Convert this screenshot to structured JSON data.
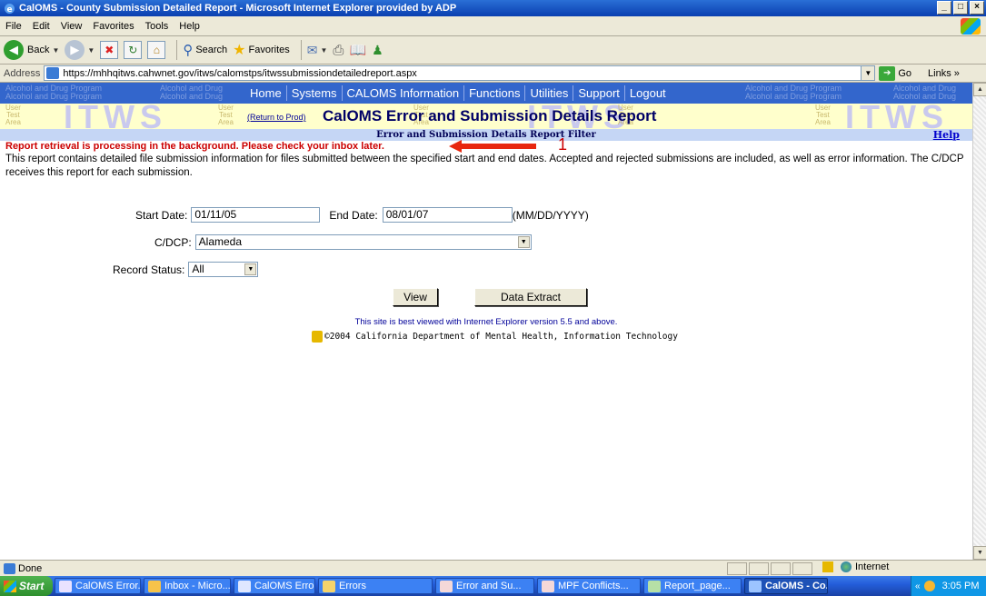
{
  "window": {
    "title": "CalOMS - County Submission Detailed Report - Microsoft Internet Explorer provided by ADP",
    "controls": [
      "_",
      "□",
      "×"
    ]
  },
  "menu": [
    "File",
    "Edit",
    "View",
    "Favorites",
    "Tools",
    "Help"
  ],
  "toolbar": {
    "back": "Back",
    "search": "Search",
    "favorites": "Favorites"
  },
  "address": {
    "label": "Address",
    "url": "https://mhhqitws.cahwnet.gov/itws/calomstps/itwssubmissiondetailedreport.aspx",
    "go": "Go",
    "links": "Links"
  },
  "nav": {
    "bg_left_1": "Alcohol and Drug Program",
    "bg_left_2": "Alcohol and Drug",
    "bg_right_1": "Alcohol and Drug Program",
    "bg_right_2": "Alcohol and Drug",
    "items": [
      "Home",
      "Systems",
      "CALOMS Information",
      "Functions",
      "Utilities",
      "Support",
      "Logout"
    ]
  },
  "banner": {
    "watermark": "ITWS",
    "watermark_right": "ITWS ITW",
    "user_test_area": "User\nTest\nArea",
    "return_link": "(Return to Prod)",
    "title": "CalOMS Error and Submission Details Report"
  },
  "filter": {
    "heading": "Error and Submission Details Report Filter",
    "help": "Help"
  },
  "notice": {
    "message": "Report retrieval is processing in the background. Please check your inbox later.",
    "callout_number": "1",
    "arrow_color": "#e8280f"
  },
  "description": "This report contains detailed file submission information for files submitted between the specified start and end dates.  Accepted and rejected submissions are included, as well as error information.  The C/DCP receives this report for each submission.",
  "form": {
    "start_label": "Start Date:",
    "start_value": "01/11/05",
    "end_label": "End Date:",
    "end_value": "08/01/07",
    "date_format": "(MM/DD/YYYY)",
    "cdcp_label": "C/DCP:",
    "cdcp_value": "Alameda",
    "status_label": "Record Status:",
    "status_value": "All",
    "view_button": "View",
    "extract_button": "Data Extract"
  },
  "footer": {
    "best_viewed": "This site is best viewed with Internet Explorer version 5.5 and above.",
    "copyright": "©2004 California Department of Mental Health, Information Technology"
  },
  "status": {
    "text": "Done",
    "zone": "Internet"
  },
  "taskbar": {
    "start": "Start",
    "tasks": [
      {
        "label": "CalOMS Error...",
        "active": false
      },
      {
        "label": "Inbox - Micro...",
        "active": false
      },
      {
        "label": "CalOMS Error...",
        "active": false
      },
      {
        "label": "Errors",
        "active": false
      },
      {
        "label": "Error and Su...",
        "active": false
      },
      {
        "label": "MPF Conflicts...",
        "active": false
      },
      {
        "label": "Report_page...",
        "active": false
      },
      {
        "label": "CalOMS - Co...",
        "active": true
      }
    ],
    "chevron": "«",
    "clock": "3:05 PM"
  },
  "colors": {
    "nav_bg": "#3366cc",
    "banner_bg": "#ffffcc",
    "warning": "#cc0000",
    "link": "#0000cc"
  }
}
